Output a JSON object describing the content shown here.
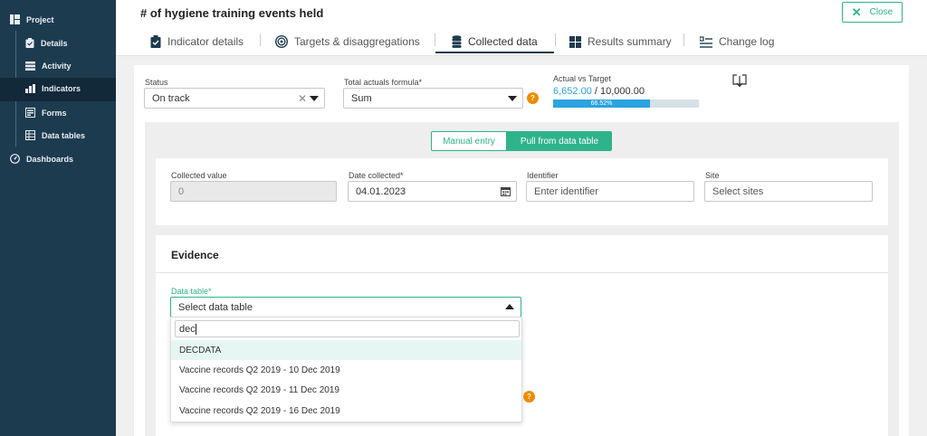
{
  "sidebar": {
    "items": [
      {
        "label": "Project"
      },
      {
        "label": "Details"
      },
      {
        "label": "Activity"
      },
      {
        "label": "Indicators"
      },
      {
        "label": "Forms"
      },
      {
        "label": "Data tables"
      },
      {
        "label": "Dashboards"
      }
    ]
  },
  "header": {
    "title": "# of hygiene training events held",
    "close_label": "Close",
    "tabs": [
      {
        "label": "Indicator details"
      },
      {
        "label": "Targets & disaggregations"
      },
      {
        "label": "Collected data"
      },
      {
        "label": "Results summary"
      },
      {
        "label": "Change log"
      }
    ]
  },
  "status": {
    "label": "Status",
    "value": "On track"
  },
  "formula": {
    "label": "Total actuals formula*",
    "value": "Sum",
    "help": "?"
  },
  "progress": {
    "label": "Actual vs Target",
    "actual": "6,652.00",
    "separator": "/",
    "target": "10,000.00",
    "percent_text": "66.52%",
    "fraction": 0.6652
  },
  "entry_mode": {
    "manual": "Manual entry",
    "pull": "Pull from data table"
  },
  "fields": {
    "collected_value": {
      "label": "Collected value",
      "value": "0"
    },
    "date_collected": {
      "label": "Date collected*",
      "value": "04.01.2023"
    },
    "identifier": {
      "label": "Identifier",
      "placeholder": "Enter identifier"
    },
    "site": {
      "label": "Site",
      "placeholder": "Select sites"
    }
  },
  "evidence": {
    "title": "Evidence",
    "data_table_label": "Data table*",
    "data_table_placeholder": "Select data table",
    "search_value": "dec",
    "options": [
      "DECDATA",
      "Vaccine records Q2 2019 - 10 Dec 2019",
      "Vaccine records Q2 2019 - 11 Dec 2019",
      "Vaccine records Q2 2019 - 16 Dec 2019"
    ],
    "help": "?"
  },
  "colors": {
    "sidebar": "#1d3b4f",
    "accent_green": "#2fb38a",
    "progress_blue": "#2ba4df",
    "help_orange": "#f08c00"
  }
}
